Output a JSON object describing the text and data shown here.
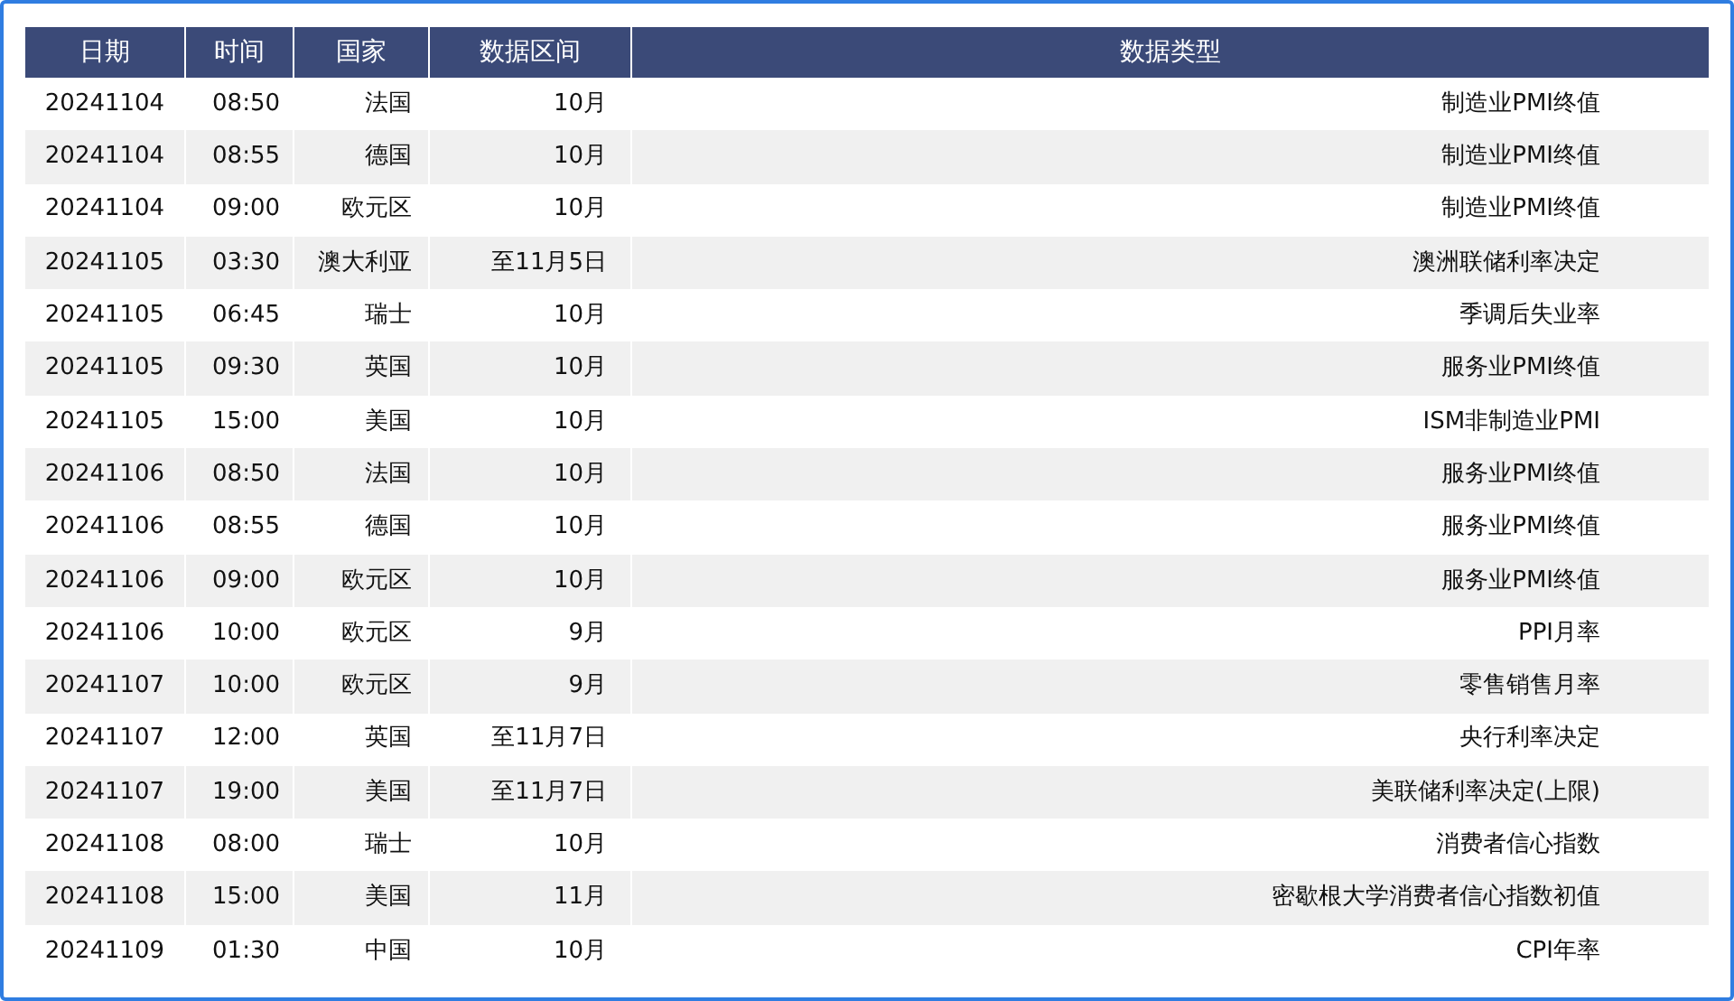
{
  "table": {
    "columns": [
      "日期",
      "时间",
      "国家",
      "数据区间",
      "数据类型"
    ],
    "rows": [
      [
        "20241104",
        "08:50",
        "法国",
        "10月",
        "制造业PMI终值"
      ],
      [
        "20241104",
        "08:55",
        "德国",
        "10月",
        "制造业PMI终值"
      ],
      [
        "20241104",
        "09:00",
        "欧元区",
        "10月",
        "制造业PMI终值"
      ],
      [
        "20241105",
        "03:30",
        "澳大利亚",
        "至11月5日",
        "澳洲联储利率决定"
      ],
      [
        "20241105",
        "06:45",
        "瑞士",
        "10月",
        "季调后失业率"
      ],
      [
        "20241105",
        "09:30",
        "英国",
        "10月",
        "服务业PMI终值"
      ],
      [
        "20241105",
        "15:00",
        "美国",
        "10月",
        "ISM非制造业PMI"
      ],
      [
        "20241106",
        "08:50",
        "法国",
        "10月",
        "服务业PMI终值"
      ],
      [
        "20241106",
        "08:55",
        "德国",
        "10月",
        "服务业PMI终值"
      ],
      [
        "20241106",
        "09:00",
        "欧元区",
        "10月",
        "服务业PMI终值"
      ],
      [
        "20241106",
        "10:00",
        "欧元区",
        "9月",
        "PPI月率"
      ],
      [
        "20241107",
        "10:00",
        "欧元区",
        "9月",
        "零售销售月率"
      ],
      [
        "20241107",
        "12:00",
        "英国",
        "至11月7日",
        "央行利率决定"
      ],
      [
        "20241107",
        "19:00",
        "美国",
        "至11月7日",
        "美联储利率决定(上限)"
      ],
      [
        "20241108",
        "08:00",
        "瑞士",
        "10月",
        "消费者信心指数"
      ],
      [
        "20241108",
        "15:00",
        "美国",
        "11月",
        "密歇根大学消费者信心指数初值"
      ],
      [
        "20241109",
        "01:30",
        "中国",
        "10月",
        "CPI年率"
      ]
    ]
  }
}
